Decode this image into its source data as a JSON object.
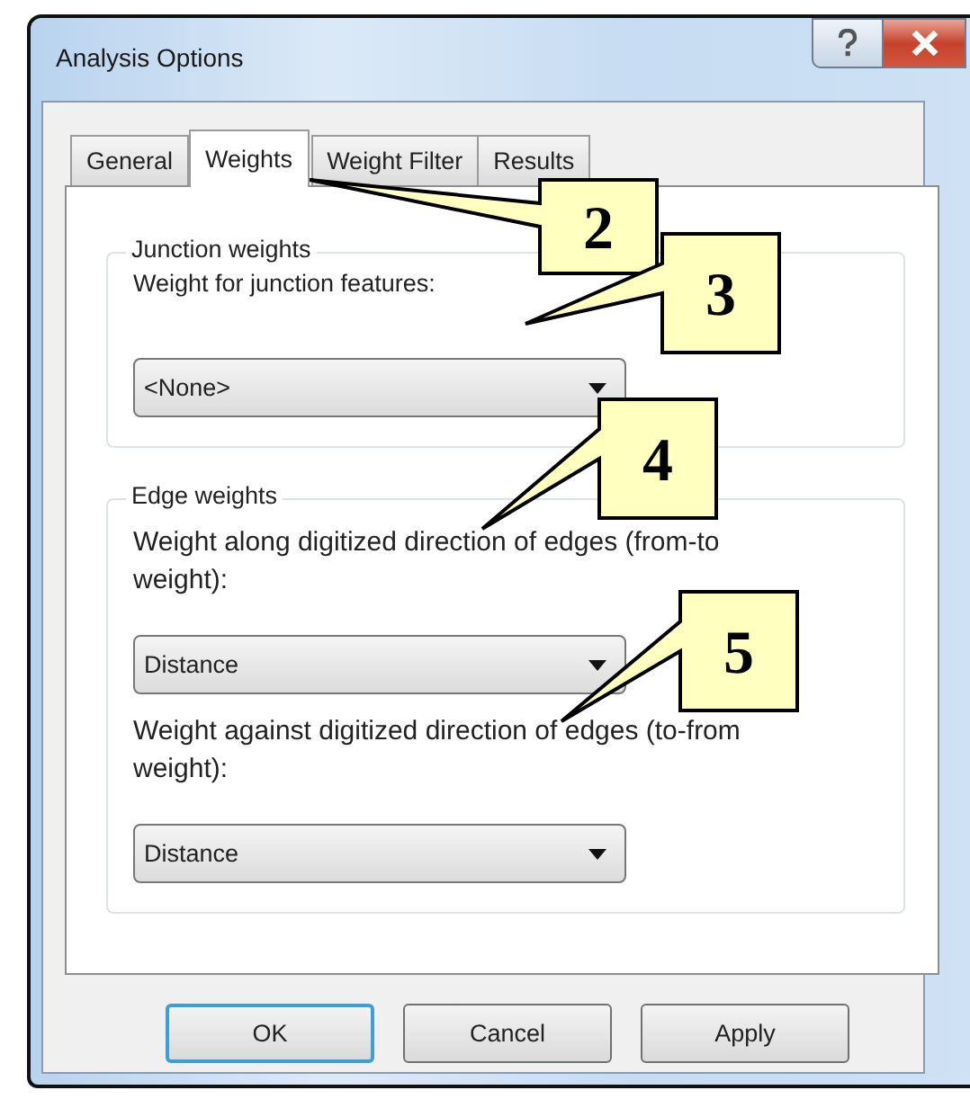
{
  "window": {
    "title": "Analysis Options"
  },
  "tabs": [
    {
      "label": "General",
      "selected": false
    },
    {
      "label": "Weights",
      "selected": true
    },
    {
      "label": "Weight Filter",
      "selected": false
    },
    {
      "label": "Results",
      "selected": false
    }
  ],
  "junction_weights": {
    "title": "Junction weights",
    "label": "Weight for junction features:",
    "dropdown": "<None>"
  },
  "edge_weights": {
    "title": "Edge weights",
    "fields": [
      {
        "label": "Weight along digitized direction of edges (from-to weight):",
        "dropdown": "Distance"
      },
      {
        "label": "Weight against digitized direction of edges (to-from weight):",
        "dropdown": "Distance"
      }
    ]
  },
  "buttons": [
    {
      "label": "OK",
      "default": true
    },
    {
      "label": "Cancel",
      "default": false
    },
    {
      "label": "Apply",
      "default": false
    }
  ],
  "callouts": [
    {
      "number": "2"
    },
    {
      "number": "3"
    },
    {
      "number": "4"
    },
    {
      "number": "5"
    }
  ]
}
